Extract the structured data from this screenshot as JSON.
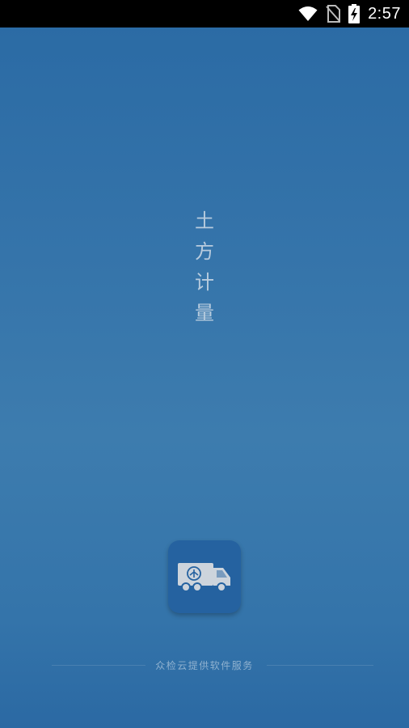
{
  "status_bar": {
    "time": "2:57",
    "icons": [
      "wifi-icon",
      "no-sim-icon",
      "battery-charging-icon"
    ]
  },
  "app": {
    "title_chars": [
      "土",
      "方",
      "计",
      "量"
    ],
    "icon_name": "truck-icon"
  },
  "footer": {
    "text": "众检云提供软件服务"
  },
  "colors": {
    "background_top": "#2a6aa4",
    "background_mid": "#3d7cae",
    "icon_bg": "#2562a0",
    "title_color": "#cfdbe7"
  }
}
